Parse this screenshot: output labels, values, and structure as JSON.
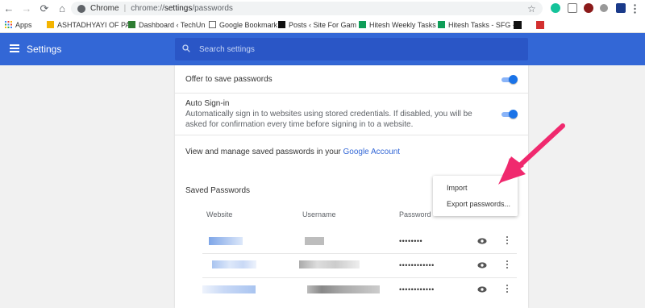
{
  "browser": {
    "nav": {
      "back": "←",
      "forward": "→",
      "reload": "⟳",
      "home": "⌂"
    },
    "omnibox": {
      "site_label": "Chrome",
      "url_prefix": "chrome://",
      "url_path": "settings",
      "url_suffix": "/passwords"
    },
    "star": "☆"
  },
  "bookmarks": [
    {
      "label": "Apps",
      "icon": "apps-grid-icon",
      "color": "#4285f4"
    },
    {
      "label": "ASHTADHYAYI OF PA",
      "icon": "bookmark-icon",
      "color": "#f4b400"
    },
    {
      "label": "Dashboard ‹ TechUn",
      "icon": "techun-icon",
      "color": "#2e7d32"
    },
    {
      "label": "Google Bookmark",
      "icon": "page-icon",
      "color": "#ffffff"
    },
    {
      "label": "Posts ‹ Site For Gam",
      "icon": "sfg-icon",
      "color": "#111111"
    },
    {
      "label": "Hitesh Weekly Tasks",
      "icon": "sheets-icon",
      "color": "#0f9d58"
    },
    {
      "label": "Hitesh Tasks - SFG -",
      "icon": "sheets-icon",
      "color": "#0f9d58"
    },
    {
      "label": "",
      "icon": "sfg-icon",
      "color": "#111111"
    },
    {
      "label": "",
      "icon": "pc-icon",
      "color": "#d32f2f"
    }
  ],
  "header": {
    "title": "Settings",
    "search_placeholder": "Search settings"
  },
  "passwords": {
    "offer_label": "Offer to save passwords",
    "auto_signin_label": "Auto Sign-in",
    "auto_signin_desc": "Automatically sign in to websites using stored credentials. If disabled, you will be asked for confirmation every time before signing in to a website.",
    "manage_text": "View and manage saved passwords in your ",
    "manage_link": "Google Account",
    "saved_heading": "Saved Passwords",
    "columns": {
      "website": "Website",
      "username": "Username",
      "password": "Password"
    },
    "rows": [
      {
        "password": "••••••••"
      },
      {
        "password": "••••••••••••"
      },
      {
        "password": "••••••••••••"
      }
    ]
  },
  "menu": {
    "import": "Import",
    "export": "Export passwords..."
  },
  "colors": {
    "header_blue": "#3367d6",
    "toggle_on": "#1a73e8",
    "arrow": "#f0296e"
  }
}
